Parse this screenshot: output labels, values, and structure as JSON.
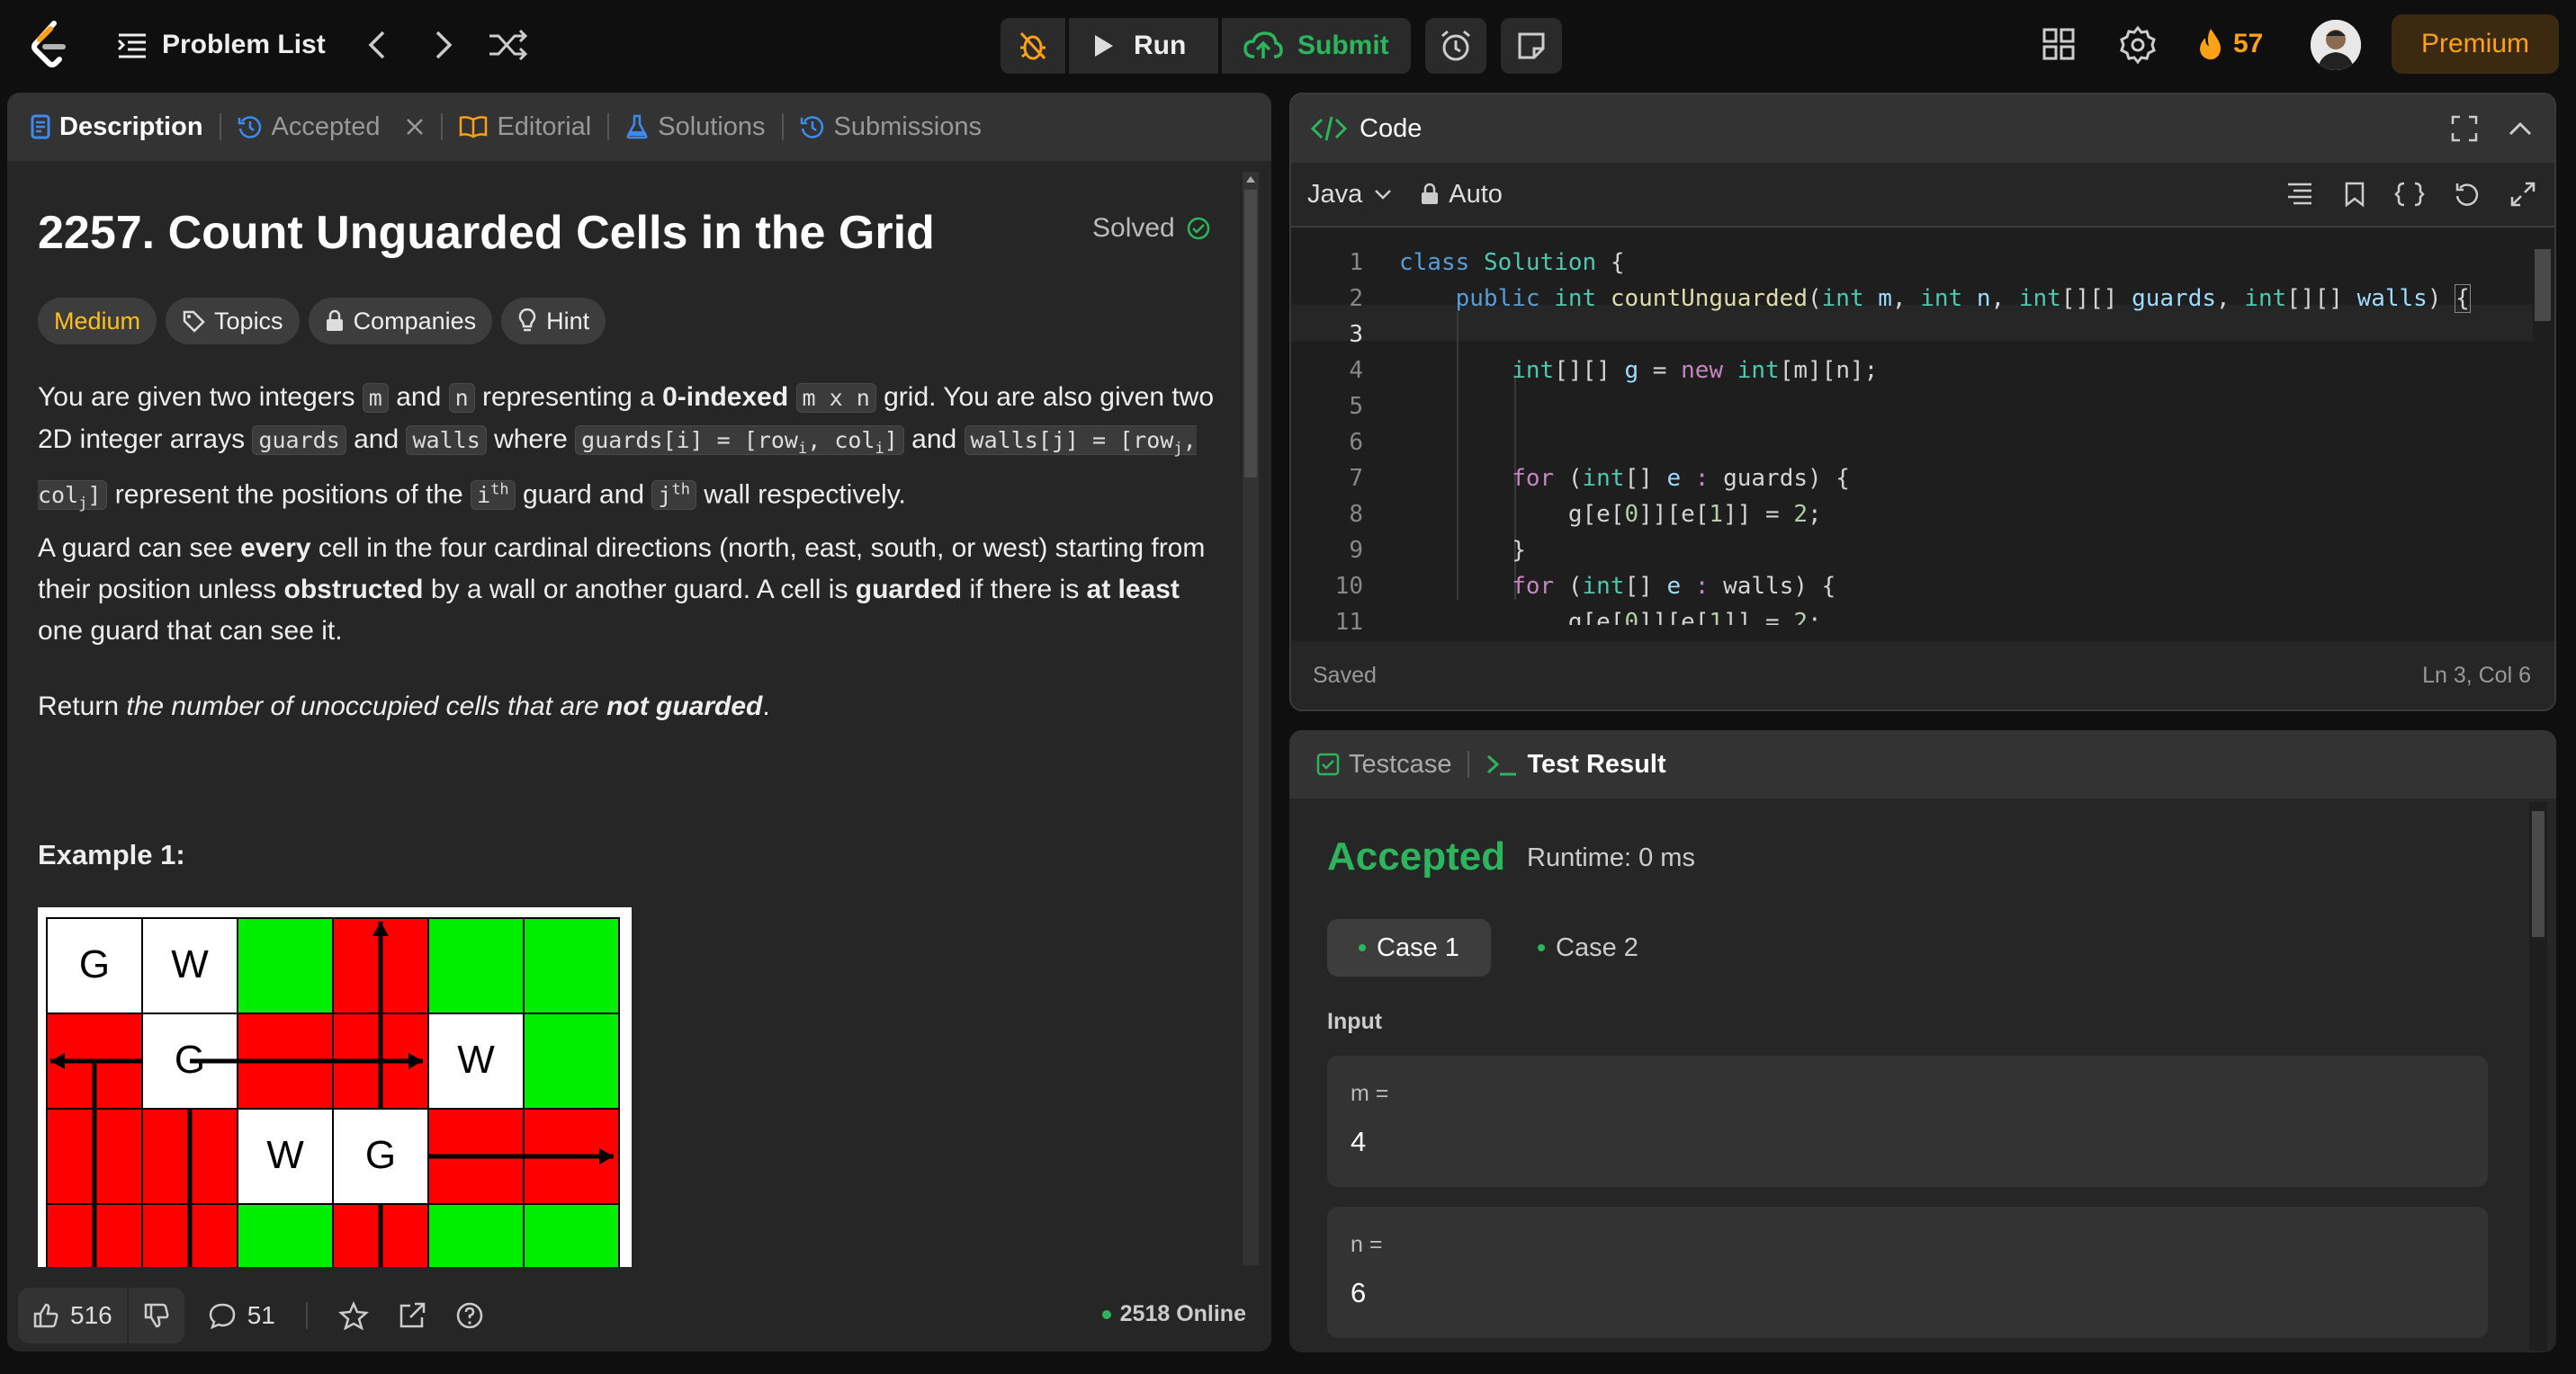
{
  "topbar": {
    "problem_list": "Problem List",
    "run": "Run",
    "submit": "Submit",
    "streak": "57",
    "premium": "Premium"
  },
  "left_tabs": [
    {
      "label": "Description"
    },
    {
      "label": "Accepted"
    },
    {
      "label": "Editorial"
    },
    {
      "label": "Solutions"
    },
    {
      "label": "Submissions"
    }
  ],
  "problem": {
    "title": "2257. Count Unguarded Cells in the Grid",
    "status": "Solved",
    "difficulty": "Medium",
    "topics": "Topics",
    "companies": "Companies",
    "hint": "Hint",
    "p1_a": "You are given two integers ",
    "m": "m",
    "and": " and ",
    "n": "n",
    "p1_b": " representing a ",
    "zero_indexed": "0-indexed",
    "mxn": "m x n",
    "p1_c": " grid. You are also given two 2D integer arrays ",
    "guards": "guards",
    "walls": "walls",
    "where": " where ",
    "guards_eq": "guards[i] = [row",
    "sub_i": "i",
    "comma_col": ", col",
    "walls_eq": "walls[j] = [row",
    "sub_j": "j",
    "close": "]",
    "p1_d": " represent the positions of the ",
    "ith": "i",
    "th": "th",
    "guard_and": " guard and ",
    "jth": "j",
    "p1_e": " wall respectively.",
    "p2_a": "A guard can see ",
    "every": "every",
    "p2_b": " cell in the four cardinal directions (north, east, south, or west) starting from their position unless ",
    "obstructed": "obstructed",
    "p2_c": " by a wall or another guard. A cell is ",
    "guarded": "guarded",
    "p2_d": " if there is ",
    "at_least": "at least",
    "p2_e": " one guard that can see it.",
    "p3_a": "Return ",
    "p3_b": "the number of unoccupied cells that are ",
    "not_guarded": "not guarded",
    "p3_c": ".",
    "example": "Example 1:",
    "grid": [
      [
        "G",
        "W",
        "g",
        "r",
        "g",
        "g"
      ],
      [
        "r",
        "G",
        "r",
        "r",
        "W",
        "g"
      ],
      [
        "r",
        "r",
        "W",
        "G",
        "r",
        "r"
      ],
      [
        "r",
        "r",
        "g",
        "r",
        "g",
        "g"
      ]
    ]
  },
  "footer": {
    "likes": "516",
    "comments": "51",
    "online": "2518 Online"
  },
  "code": {
    "header": "Code",
    "language": "Java",
    "auto": "Auto",
    "saved": "Saved",
    "cursor": "Ln 3, Col 6",
    "line_numbers": [
      "1",
      "2",
      "3",
      "4",
      "5",
      "6",
      "7",
      "8",
      "9",
      "10",
      "11"
    ]
  },
  "test": {
    "testcase": "Testcase",
    "test_result": "Test Result",
    "verdict": "Accepted",
    "runtime": "Runtime: 0 ms",
    "case1": "Case 1",
    "case2": "Case 2",
    "input": "Input",
    "m_label": "m =",
    "m_value": "4",
    "n_label": "n =",
    "n_value": "6"
  },
  "colors": {
    "accent": "#ffa116",
    "green": "#2db55d",
    "bg": "#0f0f0f",
    "panel": "#262626"
  }
}
